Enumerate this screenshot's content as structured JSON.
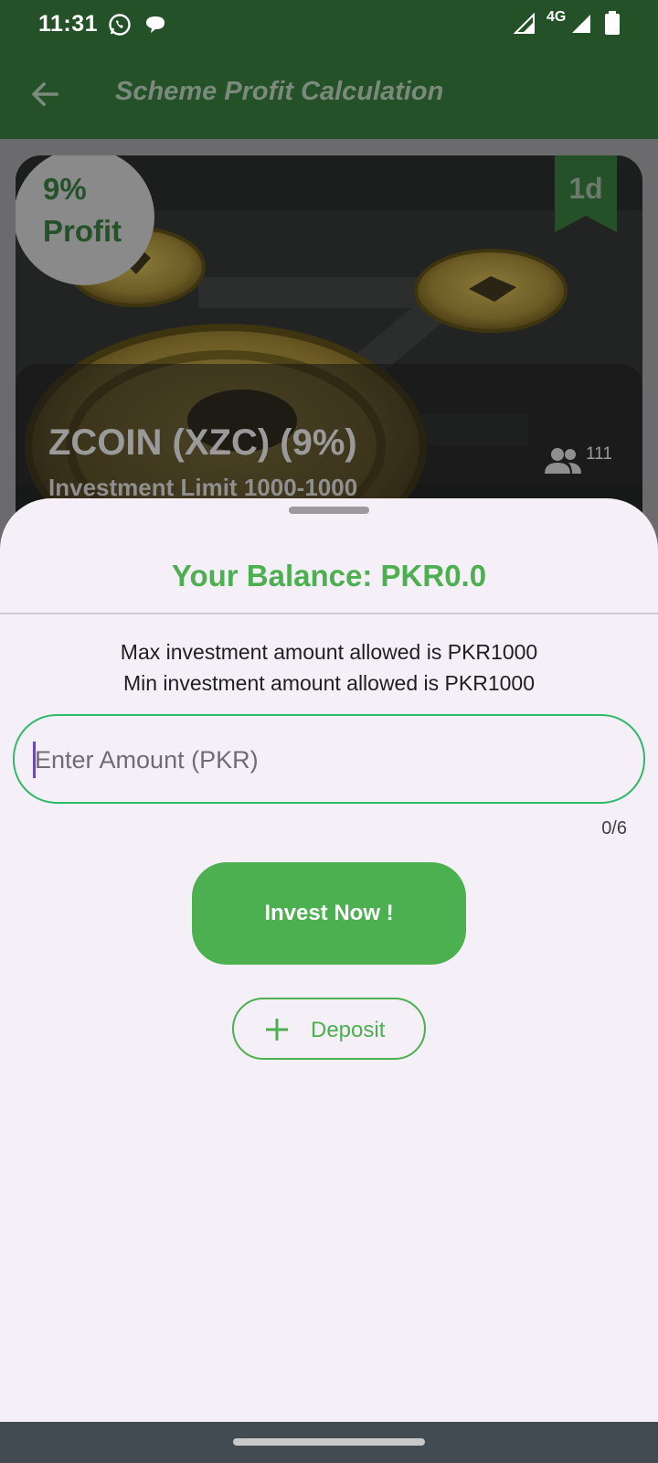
{
  "status_bar": {
    "time": "11:31",
    "network": "4G",
    "icons": [
      "whatsapp-icon",
      "chat-bubble-icon",
      "signal-icon",
      "signal-4g-icon",
      "battery-icon"
    ]
  },
  "app_bar": {
    "title": "Scheme Profit Calculation",
    "back_icon": "arrow-left-icon"
  },
  "scheme_card": {
    "profit_percent": "9%",
    "profit_label": "Profit",
    "duration": "1d",
    "name": "ZCOIN (XZC) (9%)",
    "investment_limit": "Investment Limit 1000-1000",
    "investors_count": "111",
    "investors_icon": "people-icon"
  },
  "sheet": {
    "balance": "Your Balance: PKR0.0",
    "max_note": "Max investment amount allowed is PKR1000",
    "min_note": "Min investment amount allowed is PKR1000",
    "amount_input": {
      "placeholder": "Enter Amount (PKR)",
      "value": ""
    },
    "char_counter": "0/6",
    "invest_label": "Invest Now !",
    "deposit_label": "Deposit",
    "deposit_icon": "plus-icon"
  },
  "colors": {
    "primary_dark": "#245128",
    "accent_green": "#4caf50",
    "field_border": "#2fba6a",
    "sheet_bg": "#f5eff7",
    "cursor": "#6e48b8"
  }
}
